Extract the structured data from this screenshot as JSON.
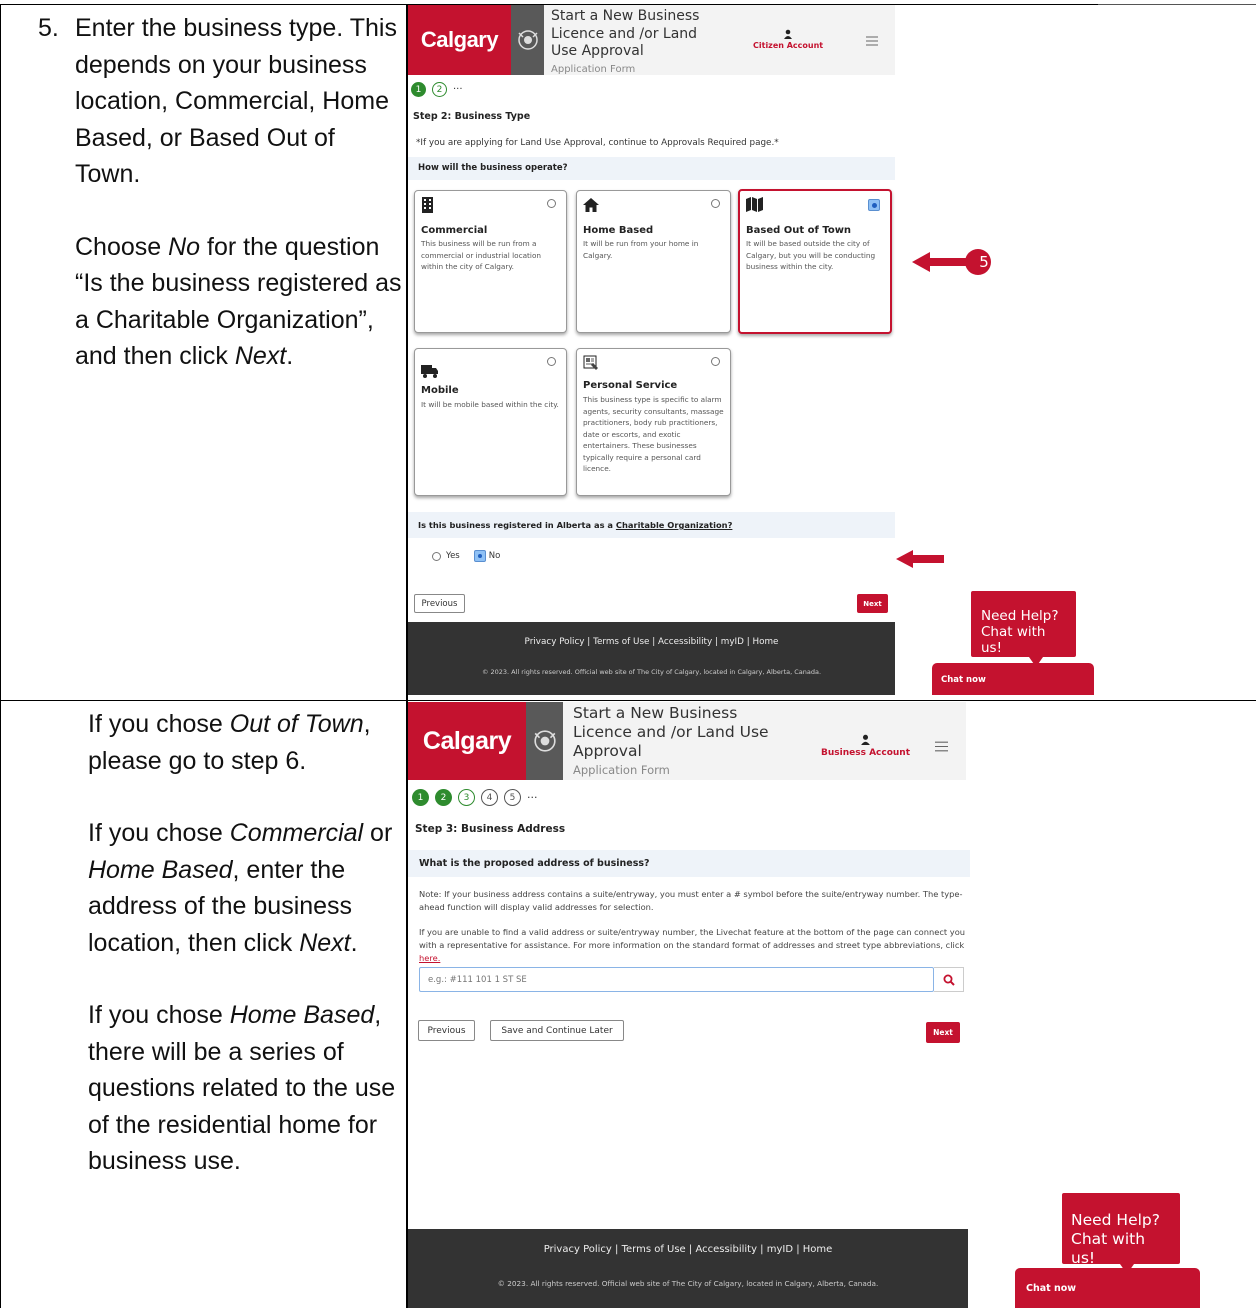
{
  "instructions": {
    "step5": {
      "number": "5.",
      "line1": "Enter the business type.",
      "body": "This depends on your business location, Commercial, Home Based, or Based Out of Town.",
      "p2_pre": "Choose ",
      "p2_em": "No",
      "p2_mid": " for the question “Is the business registered as a Charitable Organization”, and then click ",
      "p2_em2": "Next",
      "p2_end": "."
    },
    "step5b": {
      "p1_pre": "If you chose ",
      "p1_em": "Out of Town",
      "p1_end": ", please go to step 6.",
      "p2_pre": "If you chose ",
      "p2_em1": "Commercial",
      "p2_mid1": " or ",
      "p2_em2": "Home Based",
      "p2_mid2": ", enter the address of the business location, then click ",
      "p2_em3": "Next",
      "p2_end": ".",
      "p3_pre": "If you chose ",
      "p3_em": "Home Based",
      "p3_end": ", there will be a series of questions related to the use of the residential home for business use."
    }
  },
  "screen1": {
    "logo": "Calgary",
    "title_line1": "Start a New Business",
    "title_line2": "Licence and /or Land",
    "title_line3": "Use Approval",
    "subtitle": "Application Form",
    "account": "Citizen Account",
    "steps": [
      "1",
      "2"
    ],
    "more": "···",
    "step_heading": "Step 2: Business Type",
    "notice": "*If you are applying for Land Use Approval, continue to Approvals Required page.*",
    "question": "How will the business operate?",
    "cards": [
      {
        "icon": "building-icon",
        "title": "Commercial",
        "desc": "This business will be run from a commercial or industrial location within the city of Calgary.",
        "selected": false
      },
      {
        "icon": "home-icon",
        "title": "Home Based",
        "desc": "It will be run from your home in Calgary.",
        "selected": false
      },
      {
        "icon": "map-icon",
        "title": "Based Out of Town",
        "desc": "It will be based outside the city of Calgary, but you will be conducting business within the city.",
        "selected": true
      },
      {
        "icon": "truck-icon",
        "title": "Mobile",
        "desc": "It will be mobile based within the city.",
        "selected": false
      },
      {
        "icon": "id-card-icon",
        "title": "Personal Service",
        "desc": "This business type is specific to alarm agents, security consultants, massage practitioners, body rub practitioners, date or escorts, and exotic entertainers. These businesses typically require a personal card licence.",
        "selected": false
      }
    ],
    "charity_question_pre": "Is this business registered in Alberta as a ",
    "charity_question_link": "Charitable Organization?",
    "yes": "Yes",
    "no": "No",
    "selected_answer": "No",
    "previous": "Previous",
    "next": "Next",
    "footer_links": [
      "Privacy Policy",
      "Terms of Use",
      "Accessibility",
      "myID",
      "Home"
    ],
    "copyright": "© 2023. All rights reserved. Official web site of The City of Calgary, located in Calgary, Alberta, Canada.",
    "callout_number": "5",
    "help_line1": "Need Help?",
    "help_line2": "Chat with us!",
    "chat_now": "Chat now"
  },
  "screen2": {
    "logo": "Calgary",
    "title_line1": "Start a New Business",
    "title_line2": "Licence and /or Land Use",
    "title_line3": "Approval",
    "subtitle": "Application Form",
    "account": "Business Account",
    "steps": [
      "1",
      "2",
      "3",
      "4",
      "5"
    ],
    "steps_done": 2,
    "more": "···",
    "step_heading": "Step 3: Business Address",
    "question": "What is the proposed address of business?",
    "note1": "Note: If your business address contains a suite/entryway, you must enter a # symbol before the suite/entryway number. The type-ahead function will display valid addresses for selection.",
    "note2_pre": "If you are unable to find a valid address or suite/entryway number, the Livechat feature at the bottom of the page can connect you with a representative for assistance. For more information on the standard format of addresses and street type abbreviations, click ",
    "note2_link": "here.",
    "search_placeholder": "e.g.: #111 101 1 ST SE",
    "previous": "Previous",
    "save_later": "Save and Continue Later",
    "next": "Next",
    "footer_links": [
      "Privacy Policy",
      "Terms of Use",
      "Accessibility",
      "myID",
      "Home"
    ],
    "copyright": "© 2023. All rights reserved. Official web site of The City of Calgary, located in Calgary, Alberta, Canada.",
    "help_line1": "Need Help?",
    "help_line2": "Chat with us!",
    "chat_now": "Chat now"
  },
  "colors": {
    "brand_red": "#c4122f",
    "step_green": "#2e8b2e",
    "footer_dark": "#333333"
  }
}
